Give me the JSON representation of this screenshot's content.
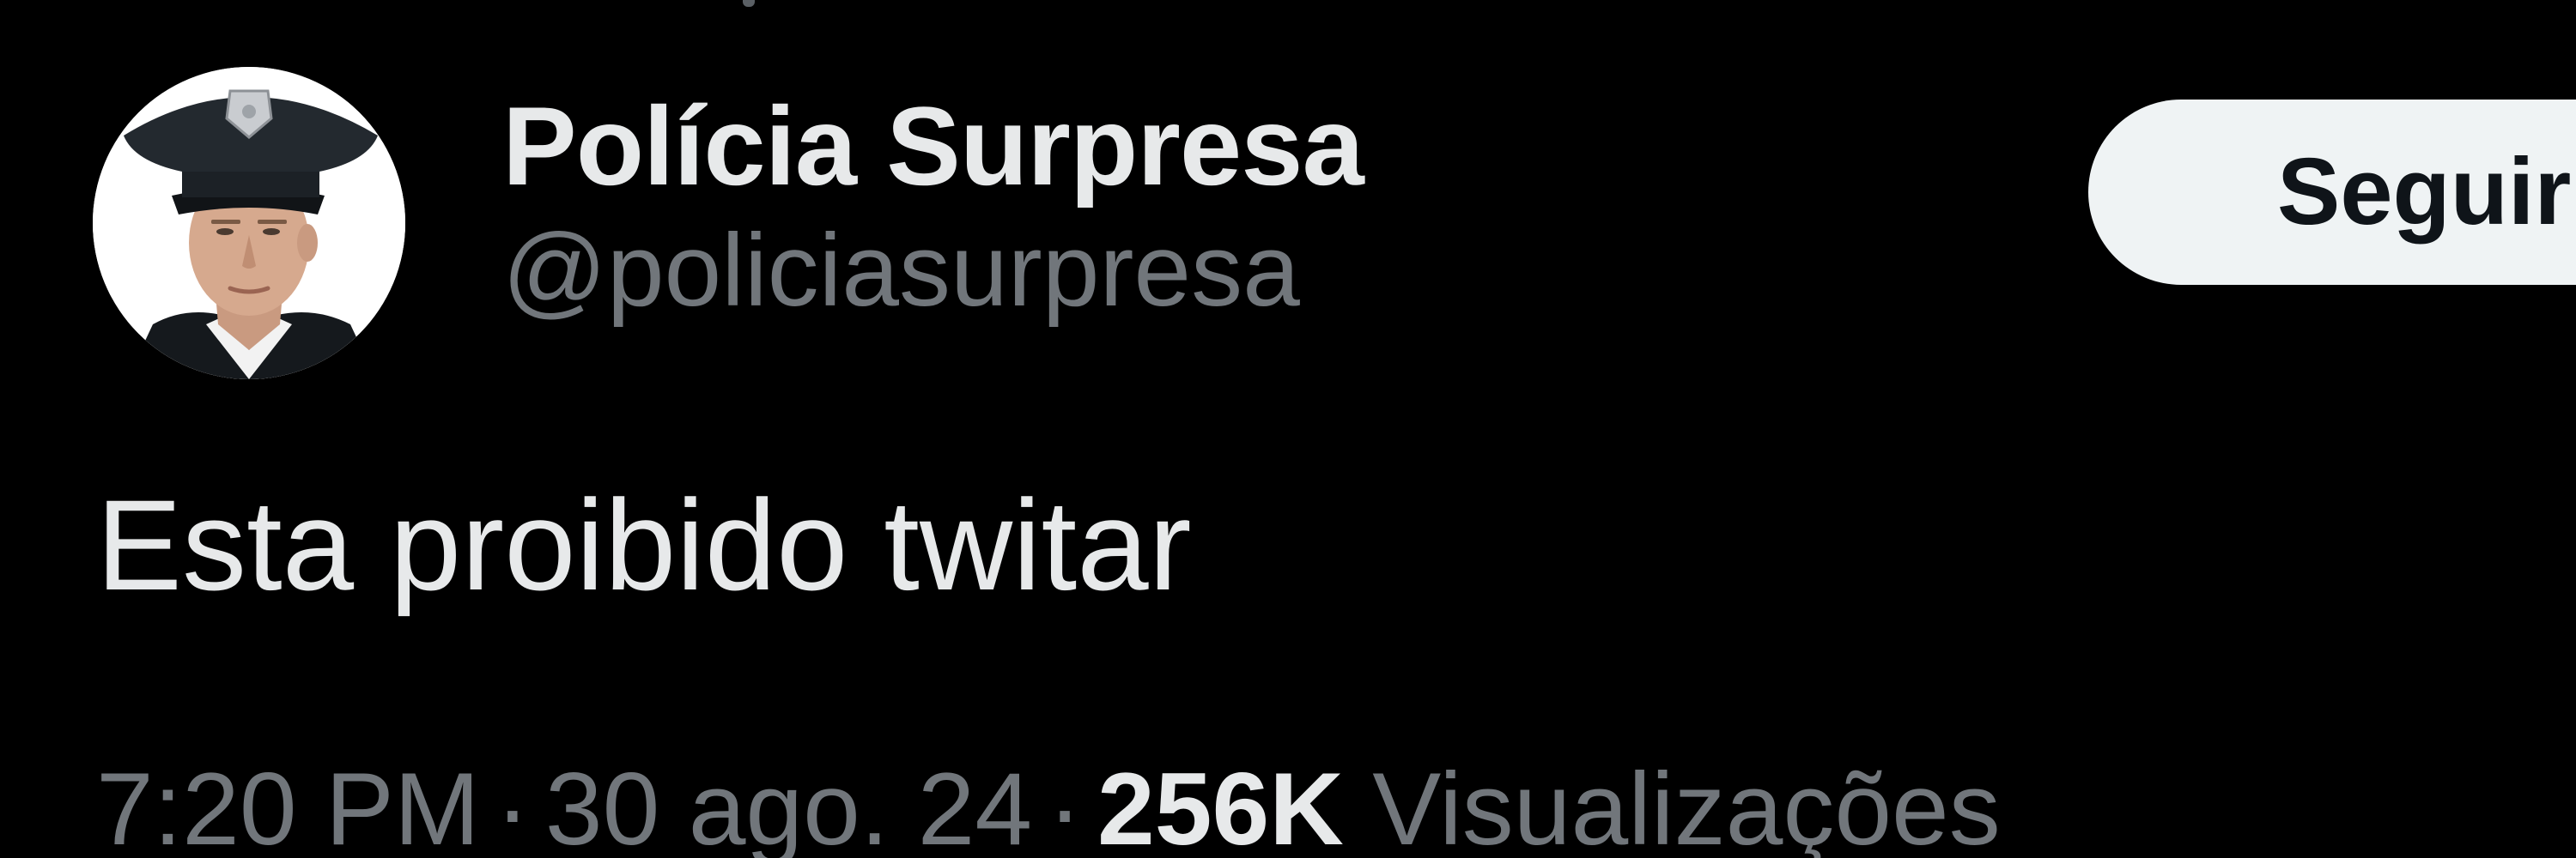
{
  "tweet": {
    "author": {
      "display_name": "Polícia Surpresa",
      "handle": "@policiasurpresa",
      "avatar_icon": "police-officer-avatar"
    },
    "follow_label": "Seguir",
    "text": "Esta proibido twitar",
    "meta": {
      "time": "7:20 PM",
      "separator": "·",
      "date": "30 ago. 24",
      "views_count": "256K",
      "views_label": "Visualizações"
    }
  },
  "colors": {
    "background": "#000000",
    "primary_text": "#e7e9ea",
    "secondary_text": "#71767b",
    "follow_button_bg": "#eff3f4",
    "follow_button_text": "#0f1419"
  }
}
